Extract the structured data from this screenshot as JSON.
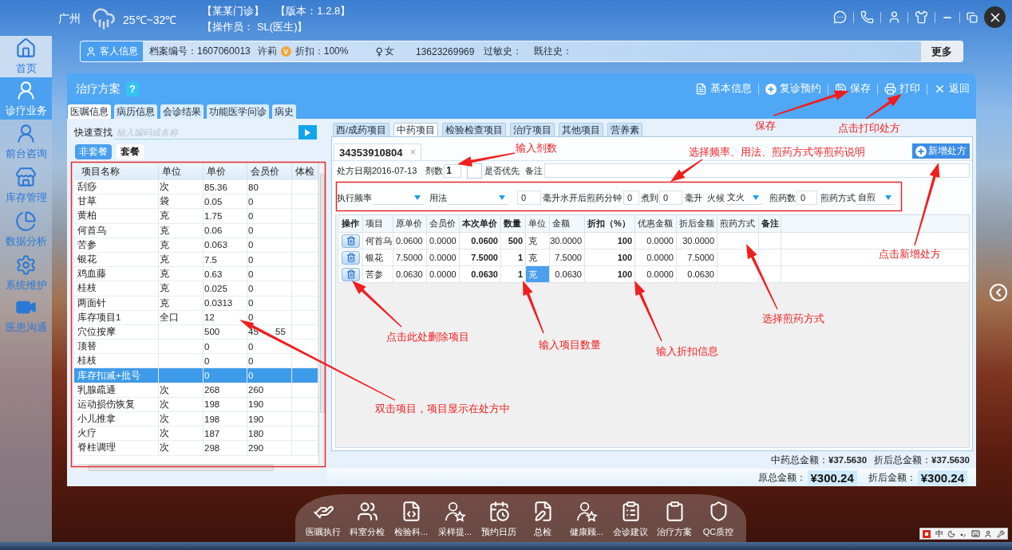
{
  "header": {
    "city": "广州",
    "temperature": "25℃~32℃",
    "clinic": "【某某门诊】",
    "version": "【版本：1.2.8】",
    "operator": "【操作员： SL(医生)】"
  },
  "sidebar": {
    "items": [
      {
        "label": "首页",
        "kind": "home",
        "selected": false,
        "hovered": true
      },
      {
        "label": "诊疗业务",
        "kind": "doctor",
        "selected": true,
        "hovered": false
      },
      {
        "label": "前台咨询",
        "kind": "nurse",
        "selected": false,
        "hovered": false
      },
      {
        "label": "库存管理",
        "kind": "store",
        "selected": false,
        "hovered": false
      },
      {
        "label": "数据分析",
        "kind": "chart",
        "selected": false,
        "hovered": false
      },
      {
        "label": "系统维护",
        "kind": "gear",
        "selected": false,
        "hovered": false
      },
      {
        "label": "医患沟通",
        "kind": "video",
        "selected": false,
        "hovered": false
      }
    ]
  },
  "patient": {
    "button": "客人信息",
    "record_no": "档案编号：1607060013",
    "name": "许莉",
    "badge": "V",
    "discount": "折扣：100%",
    "gender_symbol": "♀",
    "gender": "女",
    "phone": "13623269969",
    "allergy": "过敏史：",
    "history": "既往史：",
    "more": "更多"
  },
  "panel": {
    "title": "治疗方案",
    "help": "?",
    "actions": [
      {
        "kind": "info",
        "label": "基本信息"
      },
      {
        "kind": "appointment",
        "label": "复诊预约"
      },
      {
        "kind": "save",
        "label": "保存"
      },
      {
        "kind": "print",
        "label": "打印"
      },
      {
        "kind": "back",
        "label": "返回"
      }
    ],
    "tabs": [
      {
        "label": "医嘱信息",
        "selected": true
      },
      {
        "label": "病历信息",
        "selected": false
      },
      {
        "label": "会诊结果",
        "selected": false
      },
      {
        "label": "功能医学问诊",
        "selected": false
      },
      {
        "label": "病史",
        "selected": false
      }
    ]
  },
  "catalog": {
    "search_label": "快速查找",
    "search_placeholder": "输入编码或名称",
    "filters": [
      {
        "label": "非套餐",
        "selected": true
      },
      {
        "label": "套餐",
        "selected": false
      }
    ],
    "columns": [
      "项目名称",
      "单位",
      "单价",
      "会员价",
      "体检"
    ],
    "rows": [
      {
        "name": "刮痧",
        "unit": "次",
        "price": "85.36",
        "member_price": "80",
        "selected": false
      },
      {
        "name": "甘草",
        "unit": "袋",
        "price": "0.05",
        "member_price": "0",
        "selected": false
      },
      {
        "name": "黄柏",
        "unit": "克",
        "price": "1.75",
        "member_price": "0",
        "selected": false
      },
      {
        "name": "何首乌",
        "unit": "克",
        "price": "0.06",
        "member_price": "0",
        "selected": false
      },
      {
        "name": "苦参",
        "unit": "克",
        "price": "0.063",
        "member_price": "0",
        "selected": false
      },
      {
        "name": "银花",
        "unit": "克",
        "price": "7.5",
        "member_price": "0",
        "selected": false
      },
      {
        "name": "鸡血藤",
        "unit": "克",
        "price": "0.63",
        "member_price": "0",
        "selected": false
      },
      {
        "name": "桂枝",
        "unit": "克",
        "price": "0.025",
        "member_price": "0",
        "selected": false
      },
      {
        "name": "两面针",
        "unit": "克",
        "price": "0.0313",
        "member_price": "0",
        "selected": false
      },
      {
        "name": "库存项目1",
        "unit": "全口",
        "price": "12",
        "member_price": "0",
        "selected": false
      },
      {
        "name": "穴位按摩",
        "price": "500",
        "member_price": "45 55",
        "selected": false
      },
      {
        "name": "顶替",
        "price": "0",
        "member_price": "0",
        "selected": false
      },
      {
        "name": "桂枝",
        "price": "0",
        "member_price": "0",
        "selected": false
      },
      {
        "name": "库存扣减+批号",
        "price": "0",
        "member_price": "0",
        "selected": true
      },
      {
        "name": "乳腺疏通",
        "unit": "次",
        "price": "268",
        "member_price": "260",
        "selected": false
      },
      {
        "name": "运动损伤恢复",
        "unit": "次",
        "price": "198",
        "member_price": "190",
        "selected": false
      },
      {
        "name": "小儿推拿",
        "unit": "次",
        "price": "198",
        "member_price": "190",
        "selected": false
      },
      {
        "name": "火疗",
        "unit": "次",
        "price": "187",
        "member_price": "180",
        "selected": false
      },
      {
        "name": "脊柱调理",
        "unit": "次",
        "price": "298",
        "member_price": "290",
        "selected": false
      }
    ]
  },
  "prescription": {
    "tabs": [
      {
        "label": "西/成药项目",
        "selected": false
      },
      {
        "label": "中药项目",
        "selected": true
      },
      {
        "label": "检验检查项目",
        "selected": false
      },
      {
        "label": "治疗项目",
        "selected": false
      },
      {
        "label": "其他项目",
        "selected": false
      },
      {
        "label": "营养素",
        "selected": false
      }
    ],
    "current_tab": {
      "label": "34353910804",
      "close": "×"
    },
    "new_button": "新增处方",
    "date": "处方日期2016-07-13",
    "dose_label": "剂数",
    "dose": "1",
    "priority": {
      "label": "是否优先",
      "checked": false
    },
    "note_label": "备注",
    "options": [
      {
        "kind": "label",
        "text": "执行频率"
      },
      {
        "kind": "dropdown"
      },
      {
        "kind": "label",
        "text": "用法"
      },
      {
        "kind": "dropdown"
      },
      {
        "kind": "input",
        "value": "0"
      },
      {
        "kind": "label",
        "text": "毫升水开后煎药分钟"
      },
      {
        "kind": "input",
        "value": "0"
      },
      {
        "kind": "label",
        "text": "煮到"
      },
      {
        "kind": "input",
        "value": "0"
      },
      {
        "kind": "label",
        "text": "毫升"
      },
      {
        "kind": "label",
        "text": "火候"
      },
      {
        "kind": "dropdown",
        "value": "文火"
      },
      {
        "kind": "label",
        "text": "煎药数"
      },
      {
        "kind": "input",
        "value": "0"
      },
      {
        "kind": "label",
        "text": "煎药方式"
      },
      {
        "kind": "dropdown",
        "value": "自煎"
      }
    ],
    "columns": [
      {
        "label": "操作",
        "emphasis": true
      },
      {
        "label": "项目",
        "emphasis": false
      },
      {
        "label": "原单价",
        "emphasis": false
      },
      {
        "label": "会员价",
        "emphasis": false
      },
      {
        "label": "本次单价",
        "emphasis": true
      },
      {
        "label": "数量",
        "emphasis": true
      },
      {
        "label": "单位",
        "emphasis": false
      },
      {
        "label": "金额",
        "emphasis": false
      },
      {
        "label": "折扣（%）",
        "emphasis": true
      },
      {
        "label": "优惠金额",
        "emphasis": false
      },
      {
        "label": "折后金额",
        "emphasis": false
      },
      {
        "label": "煎药方式",
        "emphasis": false
      },
      {
        "label": "备注",
        "emphasis": true
      }
    ],
    "rows": [
      {
        "item": "何首乌",
        "original_price": "0.0600",
        "member_price": "0.0000",
        "current_price": "0.0600",
        "quantity": "500",
        "unit": {
          "text": "克",
          "selected": false
        },
        "amount": "30.0000",
        "discount": "100",
        "discount_amount": "0.0000",
        "final_amount": "30.0000"
      },
      {
        "item": "银花",
        "original_price": "7.5000",
        "member_price": "0.0000",
        "current_price": "7.5000",
        "quantity": "1",
        "unit": {
          "text": "克",
          "selected": false
        },
        "amount": "7.5000",
        "discount": "100",
        "discount_amount": "0.0000",
        "final_amount": "7.5000"
      },
      {
        "item": "苦参",
        "original_price": "0.0630",
        "member_price": "0.0000",
        "current_price": "0.0630",
        "quantity": "1",
        "unit": {
          "text": "克",
          "selected": true
        },
        "amount": "0.0630",
        "discount": "100",
        "discount_amount": "0.0000",
        "final_amount": "0.0630"
      }
    ],
    "totals": {
      "herb_label": "中药总金额：",
      "herb_value": "¥37.5630",
      "herb_discounted_label": "折后总金额：",
      "herb_discounted_value": "¥37.5630",
      "original_label": "原总金额：",
      "original_value": "¥300.24",
      "discounted_label": "折后金额：",
      "discounted_value": "¥300.24"
    }
  },
  "annotations": [
    {
      "text": "保存"
    },
    {
      "text": "点击打印处方"
    },
    {
      "text": "输入剂数"
    },
    {
      "text": "选择频率、用法、煎药方式等煎药说明"
    },
    {
      "text": "点击新增处方"
    },
    {
      "text": "选择煎药方式"
    },
    {
      "text": "点击此处删除项目"
    },
    {
      "text": "输入项目数量"
    },
    {
      "text": "输入折扣信息"
    },
    {
      "text": "双击项目，项目显示在处方中"
    }
  ],
  "dock": [
    {
      "kind": "execute",
      "label": "医嘱执行"
    },
    {
      "kind": "triage",
      "label": "科室分检"
    },
    {
      "kind": "lab",
      "label": "检验科..."
    },
    {
      "kind": "sampling",
      "label": "采样提..."
    },
    {
      "kind": "calendar",
      "label": "预约日历"
    },
    {
      "kind": "checkup",
      "label": "总检"
    },
    {
      "kind": "health",
      "label": "健康顾..."
    },
    {
      "kind": "consult",
      "label": "会诊建议"
    },
    {
      "kind": "plan",
      "label": "治疗方案"
    },
    {
      "kind": "qc",
      "label": "QC质控"
    }
  ],
  "ime": {
    "mode": "中"
  }
}
